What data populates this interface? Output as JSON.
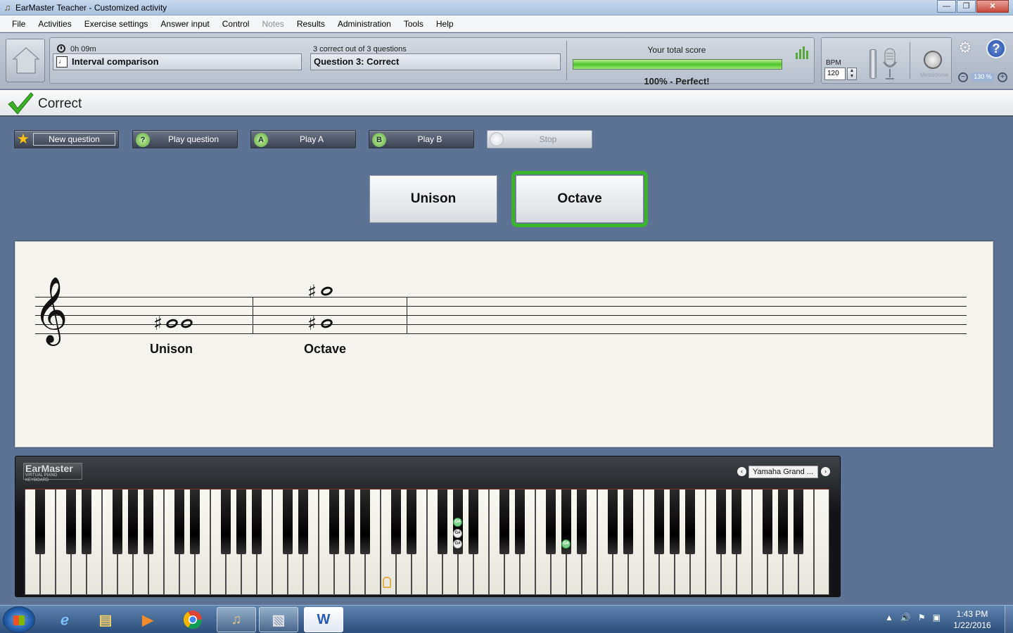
{
  "window": {
    "title": "EarMaster Teacher - Customized activity",
    "minimize": "—",
    "restore": "❐",
    "close": "✕"
  },
  "menu": [
    "File",
    "Activities",
    "Exercise settings",
    "Answer input",
    "Control",
    "Notes",
    "Results",
    "Administration",
    "Tools",
    "Help"
  ],
  "menu_disabled": [
    "Notes"
  ],
  "status": {
    "elapsed": "0h 09m",
    "activity": "Interval comparison",
    "correct_count": "3 correct out of 3 questions",
    "question": "Question 3: Correct",
    "score_title": "Your total score",
    "score_percent": 100,
    "score_text": "100% - Perfect!"
  },
  "tempo": {
    "bpm_label": "BPM",
    "bpm_value": "120",
    "metronome_label": "Metronome"
  },
  "zoom": {
    "level": "130 %"
  },
  "feedback": {
    "text": "Correct"
  },
  "controls": {
    "new_question": "New question",
    "play_question": "Play question",
    "play_a": "Play A",
    "play_b": "Play B",
    "stop": "Stop",
    "icon_q": "?",
    "icon_a": "A",
    "icon_b": "B"
  },
  "answers": [
    {
      "label": "Unison",
      "selected": false
    },
    {
      "label": "Octave",
      "selected": true
    }
  ],
  "notation": {
    "clef": "𝄞",
    "sharp": "♯",
    "labels": [
      "Unison",
      "Octave"
    ]
  },
  "piano": {
    "logo": "EarMaster",
    "logo_sub": "VIRTUAL PIANO KEYBOARD",
    "sound": "Yamaha Grand ...",
    "prev": "‹",
    "next": "›",
    "marker_label": "G#"
  },
  "taskbar": {
    "time": "1:43 PM",
    "date": "1/22/2016",
    "apps": [
      "internet-explorer",
      "file-explorer",
      "media-player",
      "chrome",
      "earmaster",
      "app",
      "word"
    ]
  },
  "colors": {
    "background": "#5d7294",
    "score_fill": "#4ec42a",
    "selected_answer": "#39b42c",
    "key_marker": "#7bd087"
  }
}
